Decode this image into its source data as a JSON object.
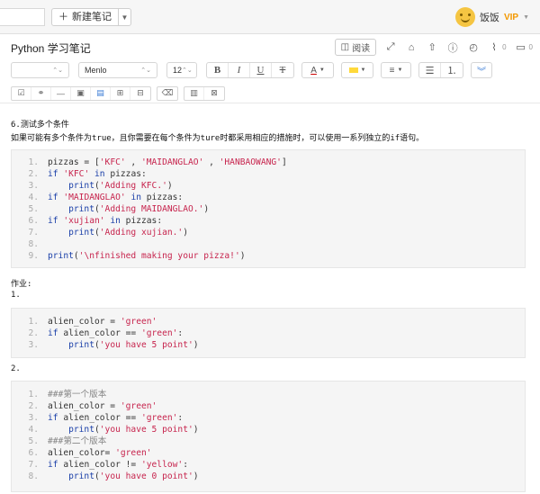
{
  "topbar": {
    "new_note_label": "新建笔记",
    "user_name": "饭饭",
    "vip_label": "VIP"
  },
  "note": {
    "title": "Python 学习笔记",
    "read_label": "阅读",
    "attachment_count": "0",
    "comment_count": "0"
  },
  "format": {
    "paragraph_select": "",
    "font_family": "Menlo",
    "font_size": "12",
    "bold": "B",
    "italic": "I",
    "underline": "U",
    "strike": "T"
  },
  "content": {
    "heading": "6.测试多个条件",
    "description": "如果可能有多个条件为true，且你需要在每个条件为ture时都采用相应的措施时，可以使用一系列独立的if语句。",
    "homework": "作业:",
    "hw1": "1.",
    "hw2": "2.",
    "block1": [
      {
        "n": "1.",
        "t": "pizzas = ['KFC' , 'MAIDANGLAO' , 'HANBAOWANG']"
      },
      {
        "n": "2.",
        "t": "if 'KFC' in pizzas:"
      },
      {
        "n": "3.",
        "t": "    print('Adding KFC.')"
      },
      {
        "n": "4.",
        "t": "if 'MAIDANGLAO' in pizzas:"
      },
      {
        "n": "5.",
        "t": "    print('Adding MAIDANGLAO.')"
      },
      {
        "n": "6.",
        "t": "if 'xujian' in pizzas:"
      },
      {
        "n": "7.",
        "t": "    print('Adding xujian.')"
      },
      {
        "n": "8.",
        "t": ""
      },
      {
        "n": "9.",
        "t": "print('\\nfinished making your pizza!')"
      }
    ],
    "block2": [
      {
        "n": "1.",
        "t": "alien_color = 'green'"
      },
      {
        "n": "2.",
        "t": "if alien_color == 'green':"
      },
      {
        "n": "3.",
        "t": "    print('you have 5 point')"
      }
    ],
    "block3": [
      {
        "n": "1.",
        "t": "###第一个版本"
      },
      {
        "n": "2.",
        "t": "alien_color = 'green'"
      },
      {
        "n": "3.",
        "t": "if alien_color == 'green':"
      },
      {
        "n": "4.",
        "t": "    print('you have 5 point')"
      },
      {
        "n": "5.",
        "t": "###第二个版本"
      },
      {
        "n": "6.",
        "t": "alien_color= 'green'"
      },
      {
        "n": "7.",
        "t": "if alien_color != 'yellow':"
      },
      {
        "n": "8.",
        "t": "    print('you have 0 point')"
      }
    ]
  }
}
